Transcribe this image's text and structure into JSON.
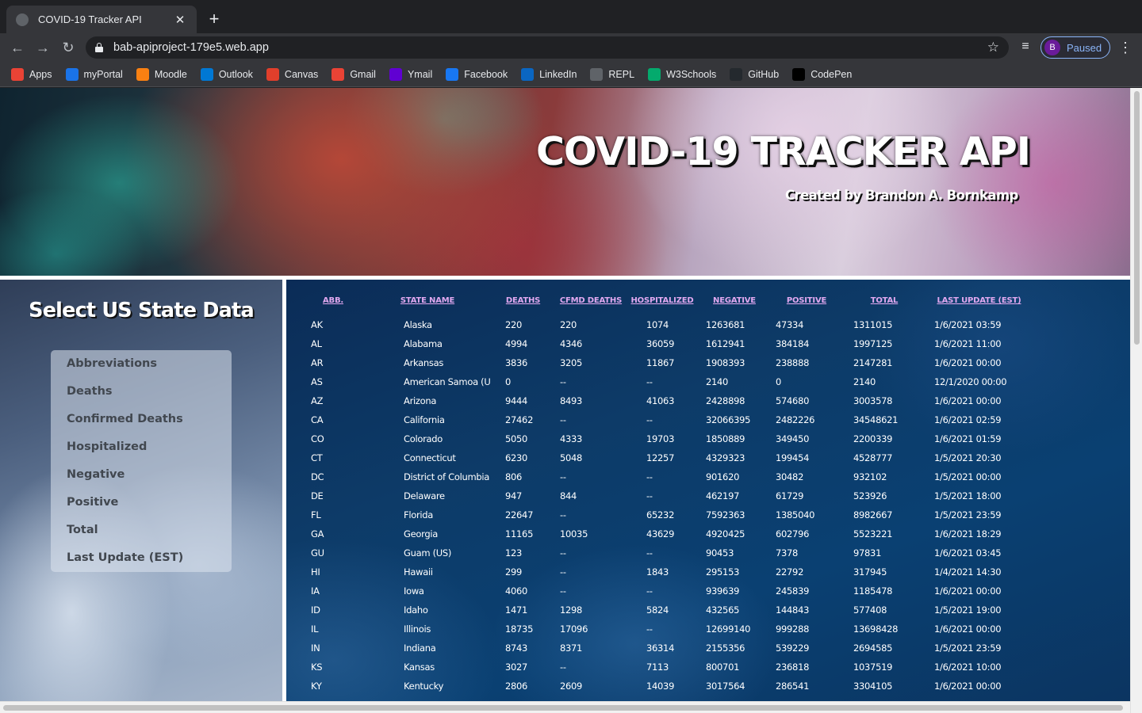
{
  "browser": {
    "tab_title": "COVID-19 Tracker API",
    "url": "bab-apiproject-179e5.web.app",
    "profile_initial": "B",
    "profile_status": "Paused",
    "bookmarks": [
      {
        "label": "Apps",
        "icon": "apps-grid-icon",
        "color": "#ea4335"
      },
      {
        "label": "myPortal",
        "icon": "myportal-icon",
        "color": "#1a73e8"
      },
      {
        "label": "Moodle",
        "icon": "moodle-icon",
        "color": "#f98012"
      },
      {
        "label": "Outlook",
        "icon": "outlook-icon",
        "color": "#0078d4"
      },
      {
        "label": "Canvas",
        "icon": "canvas-icon",
        "color": "#e13f2b"
      },
      {
        "label": "Gmail",
        "icon": "gmail-icon",
        "color": "#ea4335"
      },
      {
        "label": "Ymail",
        "icon": "ymail-icon",
        "color": "#6001d2"
      },
      {
        "label": "Facebook",
        "icon": "facebook-icon",
        "color": "#1877f2"
      },
      {
        "label": "LinkedIn",
        "icon": "linkedin-icon",
        "color": "#0a66c2"
      },
      {
        "label": "REPL",
        "icon": "repl-icon",
        "color": "#5f6368"
      },
      {
        "label": "W3Schools",
        "icon": "w3schools-icon",
        "color": "#04aa6d"
      },
      {
        "label": "GitHub",
        "icon": "github-icon",
        "color": "#24292e"
      },
      {
        "label": "CodePen",
        "icon": "codepen-icon",
        "color": "#000000"
      }
    ]
  },
  "hero": {
    "title": "COVID-19 TRACKER API",
    "subtitle": "Created by Brandon A. Bornkamp"
  },
  "sidebar": {
    "title": "Select US State Data",
    "items": [
      "Abbreviations",
      "Deaths",
      "Confirmed Deaths",
      "Hospitalized",
      "Negative",
      "Positive",
      "Total",
      "Last Update (EST)"
    ]
  },
  "table": {
    "headers": [
      "ABB.",
      "STATE NAME",
      "DEATHS",
      "CFMD DEATHS",
      "HOSPITALIZED",
      "NEGATIVE",
      "POSITIVE",
      "TOTAL",
      "LAST UPDATE (EST)"
    ],
    "rows": [
      [
        "AK",
        "Alaska",
        "220",
        "220",
        "1074",
        "1263681",
        "47334",
        "1311015",
        "1/6/2021 03:59"
      ],
      [
        "AL",
        "Alabama",
        "4994",
        "4346",
        "36059",
        "1612941",
        "384184",
        "1997125",
        "1/6/2021 11:00"
      ],
      [
        "AR",
        "Arkansas",
        "3836",
        "3205",
        "11867",
        "1908393",
        "238888",
        "2147281",
        "1/6/2021 00:00"
      ],
      [
        "AS",
        "American Samoa (US)",
        "0",
        "--",
        "--",
        "2140",
        "0",
        "2140",
        "12/1/2020 00:00"
      ],
      [
        "AZ",
        "Arizona",
        "9444",
        "8493",
        "41063",
        "2428898",
        "574680",
        "3003578",
        "1/6/2021 00:00"
      ],
      [
        "CA",
        "California",
        "27462",
        "--",
        "--",
        "32066395",
        "2482226",
        "34548621",
        "1/6/2021 02:59"
      ],
      [
        "CO",
        "Colorado",
        "5050",
        "4333",
        "19703",
        "1850889",
        "349450",
        "2200339",
        "1/6/2021 01:59"
      ],
      [
        "CT",
        "Connecticut",
        "6230",
        "5048",
        "12257",
        "4329323",
        "199454",
        "4528777",
        "1/5/2021 20:30"
      ],
      [
        "DC",
        "District of Columbia (US)",
        "806",
        "--",
        "--",
        "901620",
        "30482",
        "932102",
        "1/5/2021 00:00"
      ],
      [
        "DE",
        "Delaware",
        "947",
        "844",
        "--",
        "462197",
        "61729",
        "523926",
        "1/5/2021 18:00"
      ],
      [
        "FL",
        "Florida",
        "22647",
        "--",
        "65232",
        "7592363",
        "1385040",
        "8982667",
        "1/5/2021 23:59"
      ],
      [
        "GA",
        "Georgia",
        "11165",
        "10035",
        "43629",
        "4920425",
        "602796",
        "5523221",
        "1/6/2021 18:29"
      ],
      [
        "GU",
        "Guam (US)",
        "123",
        "--",
        "--",
        "90453",
        "7378",
        "97831",
        "1/6/2021 03:45"
      ],
      [
        "HI",
        "Hawaii",
        "299",
        "--",
        "1843",
        "295153",
        "22792",
        "317945",
        "1/4/2021 14:30"
      ],
      [
        "IA",
        "Iowa",
        "4060",
        "--",
        "--",
        "939639",
        "245839",
        "1185478",
        "1/6/2021 00:00"
      ],
      [
        "ID",
        "Idaho",
        "1471",
        "1298",
        "5824",
        "432565",
        "144843",
        "577408",
        "1/5/2021 19:00"
      ],
      [
        "IL",
        "Illinois",
        "18735",
        "17096",
        "--",
        "12699140",
        "999288",
        "13698428",
        "1/6/2021 00:00"
      ],
      [
        "IN",
        "Indiana",
        "8743",
        "8371",
        "36314",
        "2155356",
        "539229",
        "2694585",
        "1/5/2021 23:59"
      ],
      [
        "KS",
        "Kansas",
        "3027",
        "--",
        "7113",
        "800701",
        "236818",
        "1037519",
        "1/6/2021 10:00"
      ],
      [
        "KY",
        "Kentucky",
        "2806",
        "2609",
        "14039",
        "3017564",
        "286541",
        "3304105",
        "1/6/2021 00:00"
      ]
    ]
  }
}
